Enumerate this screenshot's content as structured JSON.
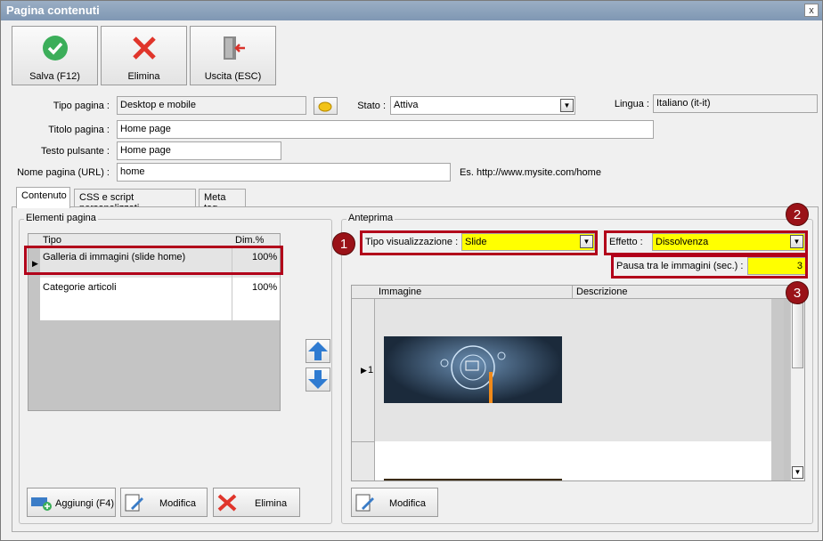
{
  "window": {
    "title": "Pagina contenuti",
    "close_glyph": "x"
  },
  "toolbar": {
    "save_label": "Salva (F12)",
    "delete_label": "Elimina",
    "exit_label": "Uscita (ESC)"
  },
  "form": {
    "page_type_label": "Tipo pagina :",
    "page_type_value": "Desktop e mobile",
    "status_label": "Stato :",
    "status_value": "Attiva",
    "language_label": "Lingua :",
    "language_value": "Italiano (it-it)",
    "title_label": "Titolo pagina :",
    "title_value": "Home page",
    "button_text_label": "Testo pulsante :",
    "button_text_value": "Home page",
    "url_label": "Nome pagina (URL) :",
    "url_value": "home",
    "url_example": "Es. http://www.mysite.com/home"
  },
  "tabs": [
    "Contenuto",
    "CSS e script personalizzati",
    "Meta tag"
  ],
  "elements": {
    "title": "Elementi pagina",
    "columns": [
      "Tipo",
      "Dim.%"
    ],
    "rows": [
      {
        "tipo": "Galleria di immagini (slide home)",
        "dim": "100%"
      },
      {
        "tipo": "Categorie articoli",
        "dim": "100%"
      }
    ],
    "add_label": "Aggiungi (F4)",
    "edit_label": "Modifica",
    "delete_label": "Elimina"
  },
  "preview": {
    "title": "Anteprima",
    "display_type_label": "Tipo visualizzazione :",
    "display_type_value": "Slide",
    "effect_label": "Effetto :",
    "effect_value": "Dissolvenza",
    "pause_label": "Pausa tra le immagini (sec.) :",
    "pause_value": "3",
    "columns": [
      "Immagine",
      "Descrizione"
    ],
    "row_number": "1",
    "edit_label": "Modifica"
  },
  "callouts": [
    "1",
    "2",
    "3"
  ],
  "colors": {
    "accent_red": "#b2001a",
    "highlight": "#ffff00",
    "callout": "#9a1218",
    "save_green": "#3cae5a",
    "delete_red": "#e0352b"
  }
}
